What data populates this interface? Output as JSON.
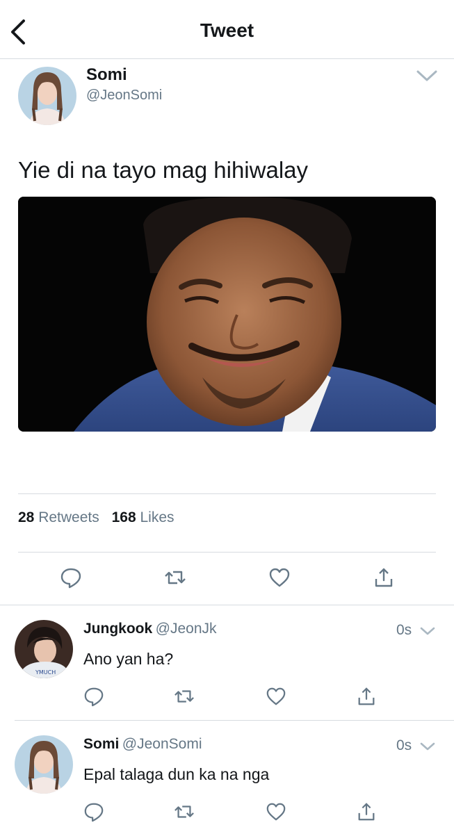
{
  "header": {
    "title": "Tweet"
  },
  "tweet": {
    "name": "Somi",
    "handle": "@JeonSomi",
    "text": "Yie di na tayo mag hihiwalay",
    "retweets_count": "28",
    "retweets_label": "Retweets",
    "likes_count": "168",
    "likes_label": "Likes"
  },
  "replies": [
    {
      "name": "Jungkook",
      "handle": "@JeonJk",
      "time": "0s",
      "text": "Ano yan ha?"
    },
    {
      "name": "Somi",
      "handle": "@JeonSomi",
      "time": "0s",
      "text": "Epal talaga dun ka na nga"
    }
  ],
  "icons": {
    "back": "chevron-left-icon",
    "more": "chevron-down-icon",
    "reply": "speech-bubble-icon",
    "retweet": "retweet-icon",
    "like": "heart-icon",
    "share": "share-icon"
  },
  "colors": {
    "text": "#14171a",
    "secondary": "#657786",
    "icon": "#657786",
    "divider": "#d7dbe0"
  }
}
